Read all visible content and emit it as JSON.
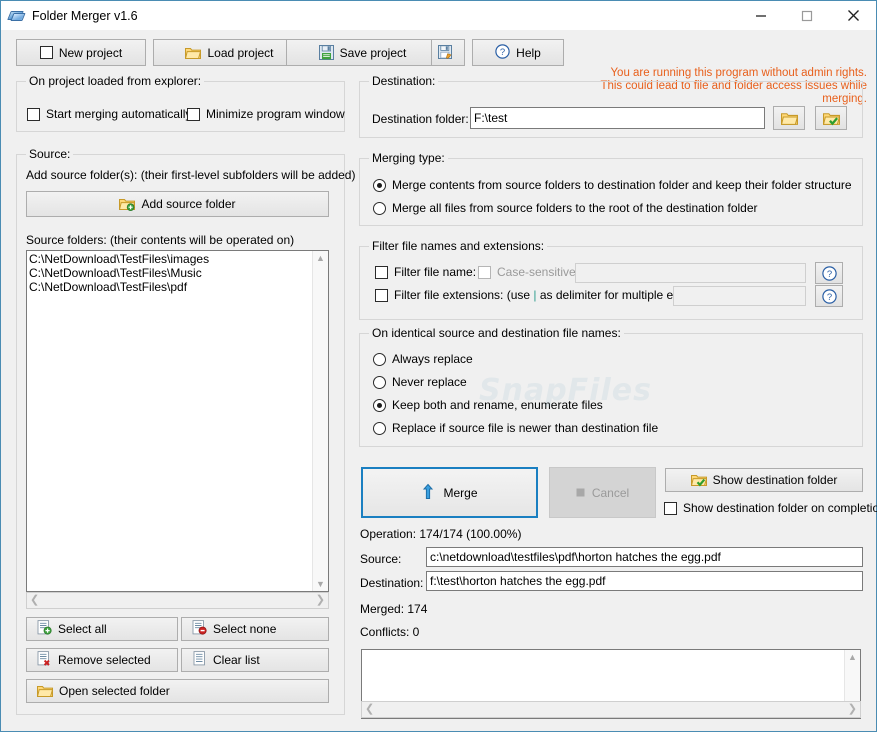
{
  "window": {
    "title": "Folder Merger v1.6",
    "icon": "app-folders-icon",
    "minimize": "minimize-icon",
    "maximize": "maximize-icon",
    "close": "close-icon",
    "accent_color": "#4a8cb3"
  },
  "toolbar": {
    "new_project": "New project",
    "load_project": "Load project",
    "save_project": "Save project",
    "save_project_as": "",
    "help": "Help"
  },
  "warning": {
    "line1": "You are running this program without admin rights.",
    "line2": "This could lead to file and folder access issues while merging.",
    "color": "#e8601c"
  },
  "explorer_group": {
    "title": "On project loaded from explorer:",
    "start_merging": {
      "label": "Start merging automatically",
      "checked": false
    },
    "minimize_window": {
      "label": "Minimize program window",
      "checked": false
    }
  },
  "source_group": {
    "title": "Source:",
    "add_hint": "Add source folder(s): (their first-level subfolders will be added)",
    "add_button": "Add source folder",
    "list_hint": "Source folders: (their contents will be operated on)",
    "folders": [
      "C:\\NetDownload\\TestFiles\\images",
      "C:\\NetDownload\\TestFiles\\Music",
      "C:\\NetDownload\\TestFiles\\pdf"
    ],
    "select_all": "Select all",
    "select_none": "Select none",
    "remove_selected": "Remove selected",
    "clear_list": "Clear list",
    "open_selected_folder": "Open selected folder"
  },
  "destination_group": {
    "title": "Destination:",
    "label": "Destination folder:",
    "value": "F:\\test",
    "placeholder": "",
    "browse_icon": "folder-open-icon",
    "open_icon": "folder-check-icon"
  },
  "merging_type_group": {
    "title": "Merging type:",
    "options": [
      {
        "label": "Merge contents from source folders to destination folder and keep their folder structure",
        "selected": true
      },
      {
        "label": "Merge all files from source folders to the root of the destination folder",
        "selected": false
      }
    ]
  },
  "filter_group": {
    "title": "Filter file names and extensions:",
    "file_name": {
      "label": "Filter file name:",
      "checked": false,
      "value": "",
      "help": "?"
    },
    "case_sensitive": {
      "label": "Case-sensitive",
      "checked": false,
      "disabled": true
    },
    "extensions": {
      "label_a": "Filter file extensions: (use ",
      "delimiter": "|",
      "label_b": " as delimiter for multiple entries)",
      "checked": false,
      "value": "",
      "help": "?"
    },
    "delimiter_color": "#2f9e8f"
  },
  "identical_group": {
    "title": "On identical source and destination file names:",
    "options": [
      {
        "label": "Always replace",
        "selected": false
      },
      {
        "label": "Never replace",
        "selected": false
      },
      {
        "label": "Keep both and rename, enumerate files",
        "selected": true
      },
      {
        "label": "Replace if source file is newer than destination file",
        "selected": false
      }
    ]
  },
  "actions": {
    "merge": "Merge",
    "merge_icon": "merge-arrow-icon",
    "cancel": "Cancel",
    "cancel_icon": "stop-square-icon",
    "show_destination": "Show destination folder",
    "show_destination_icon": "folder-check-icon",
    "show_on_completion": {
      "label": "Show destination folder on completion",
      "checked": false
    }
  },
  "status": {
    "operation": "Operation: 174/174 (100.00%)",
    "source_label": "Source:",
    "source_value": "c:\\netdownload\\testfiles\\pdf\\horton hatches the egg.pdf",
    "destination_label": "Destination:",
    "destination_value": "f:\\test\\horton hatches the egg.pdf",
    "merged": "Merged: 174",
    "conflicts": "Conflicts: 0",
    "log": ""
  },
  "watermark": "SnapFiles"
}
